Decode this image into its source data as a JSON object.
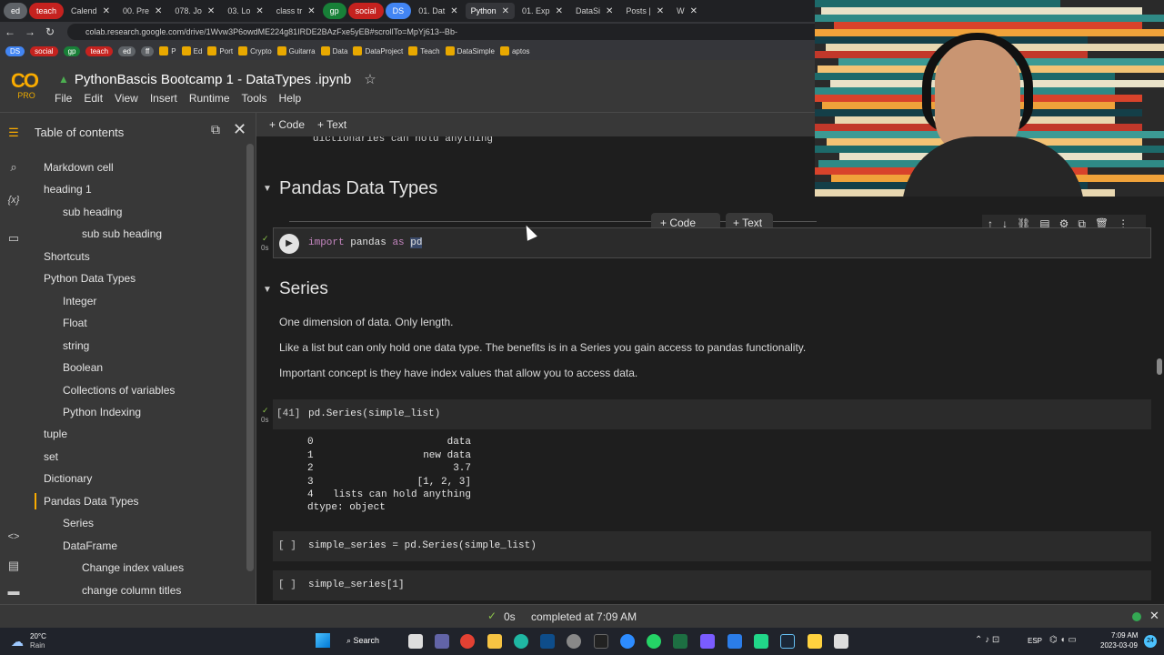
{
  "browser": {
    "tabs": [
      {
        "label": "ed",
        "kind": "chip",
        "color": "#5f6368"
      },
      {
        "label": "teach",
        "kind": "chip",
        "color": "#c5221f"
      },
      {
        "label": "Calend",
        "kind": "tab"
      },
      {
        "label": "00. Pre",
        "kind": "tab"
      },
      {
        "label": "078. Jo",
        "kind": "tab"
      },
      {
        "label": "03. Lo",
        "kind": "tab"
      },
      {
        "label": "class tr",
        "kind": "tab"
      },
      {
        "label": "gp",
        "kind": "chip",
        "color": "#188038"
      },
      {
        "label": "social",
        "kind": "chip",
        "color": "#c5221f"
      },
      {
        "label": "DS",
        "kind": "chip",
        "color": "#4285f4"
      },
      {
        "label": "01. Dat",
        "kind": "tab"
      },
      {
        "label": "Python",
        "kind": "tab",
        "active": true
      },
      {
        "label": "01. Exp",
        "kind": "tab"
      },
      {
        "label": "DataSi",
        "kind": "tab"
      },
      {
        "label": "Posts |",
        "kind": "tab"
      },
      {
        "label": "W",
        "kind": "tab"
      }
    ],
    "url": "colab.research.google.com/drive/1Wvw3P6owdME224g81IRDE2BAzFxe5yEB#scrollTo=MpYj613--Bb-",
    "bookmarks": [
      {
        "label": "DS",
        "kind": "chip",
        "color": "#4285f4"
      },
      {
        "label": "social",
        "kind": "chip",
        "color": "#c5221f"
      },
      {
        "label": "gp",
        "kind": "chip",
        "color": "#188038"
      },
      {
        "label": "teach",
        "kind": "chip",
        "color": "#c5221f"
      },
      {
        "label": "ed",
        "kind": "chip",
        "color": "#5f6368"
      },
      {
        "label": "ff",
        "kind": "chip",
        "color": "#5f6368"
      },
      {
        "label": "P",
        "kind": "bm"
      },
      {
        "label": "Ed",
        "kind": "bm"
      },
      {
        "label": "Port",
        "kind": "bm"
      },
      {
        "label": "Crypto",
        "kind": "bm"
      },
      {
        "label": "Guitarra",
        "kind": "bm"
      },
      {
        "label": "Data",
        "kind": "bm"
      },
      {
        "label": "DataProject",
        "kind": "bm"
      },
      {
        "label": "Teach",
        "kind": "bm"
      },
      {
        "label": "DataSimple",
        "kind": "bm"
      },
      {
        "label": "aptos",
        "kind": "bm"
      }
    ]
  },
  "colab": {
    "logo": "CO",
    "tier": "PRO",
    "notebook_title": "PythonBascis Bootcamp 1 - DataTypes .ipynb",
    "menu": [
      "File",
      "Edit",
      "View",
      "Insert",
      "Runtime",
      "Tools",
      "Help"
    ],
    "toolbar": {
      "code": "Code",
      "text": "Text"
    }
  },
  "toc": {
    "title": "Table of contents",
    "items": [
      {
        "label": "Markdown cell",
        "level": 1
      },
      {
        "label": "heading 1",
        "level": 1
      },
      {
        "label": "sub heading",
        "level": 2
      },
      {
        "label": "sub sub heading",
        "level": 3
      },
      {
        "label": "Shortcuts",
        "level": 1
      },
      {
        "label": "Python Data Types",
        "level": 1
      },
      {
        "label": "Integer",
        "level": 2
      },
      {
        "label": "Float",
        "level": 2
      },
      {
        "label": "string",
        "level": 2
      },
      {
        "label": "Boolean",
        "level": 2
      },
      {
        "label": "Collections of variables",
        "level": 2
      },
      {
        "label": "Python Indexing",
        "level": 2
      },
      {
        "label": "tuple",
        "level": 1
      },
      {
        "label": "set",
        "level": 1
      },
      {
        "label": "Dictionary",
        "level": 1
      },
      {
        "label": "Pandas Data Types",
        "level": 1,
        "active": true
      },
      {
        "label": "Series",
        "level": 2
      },
      {
        "label": "DataFrame",
        "level": 2
      },
      {
        "label": "Change index values",
        "level": 3
      },
      {
        "label": "change column titles",
        "level": 3
      }
    ]
  },
  "notebook": {
    "top_partial": "dictionaries can hold anything",
    "section1": "Pandas Data Types",
    "add_code": "Code",
    "add_text": "Text",
    "cell_import": {
      "kw1": "import",
      "mod": "pandas",
      "kw2": "as",
      "alias": "pd",
      "time": "0s"
    },
    "section2": "Series",
    "para1": "One dimension of data. Only length.",
    "para2": "Like a list but can only hold one data type. The benefits is in a Series you gain access to pandas functionality.",
    "para3": "Important concept is they have index values that allow you to access data.",
    "cell41": {
      "prompt": "[41]",
      "code": "pd.Series(simple_list)",
      "time": "0s"
    },
    "output41": [
      {
        "idx": "0",
        "val": "data"
      },
      {
        "idx": "1",
        "val": "new data"
      },
      {
        "idx": "2",
        "val": "3.7"
      },
      {
        "idx": "3",
        "val": "[1, 2, 3]"
      },
      {
        "idx": "4",
        "val": "lists can hold anything"
      }
    ],
    "dtype": "dtype: object",
    "cell_a": {
      "prompt": "[ ]",
      "code": "simple_series = pd.Series(simple_list)"
    },
    "cell_b": {
      "prompt": "[ ]",
      "code": "simple_series[1]"
    }
  },
  "status": {
    "check": "✓",
    "time": "0s",
    "text": "completed at 7:09 AM"
  },
  "taskbar": {
    "temp": "20°C",
    "weather": "Rain",
    "search": "Search",
    "lang": "ESP",
    "time": "7:09 AM",
    "date": "2023-03-09",
    "badge": "24"
  }
}
